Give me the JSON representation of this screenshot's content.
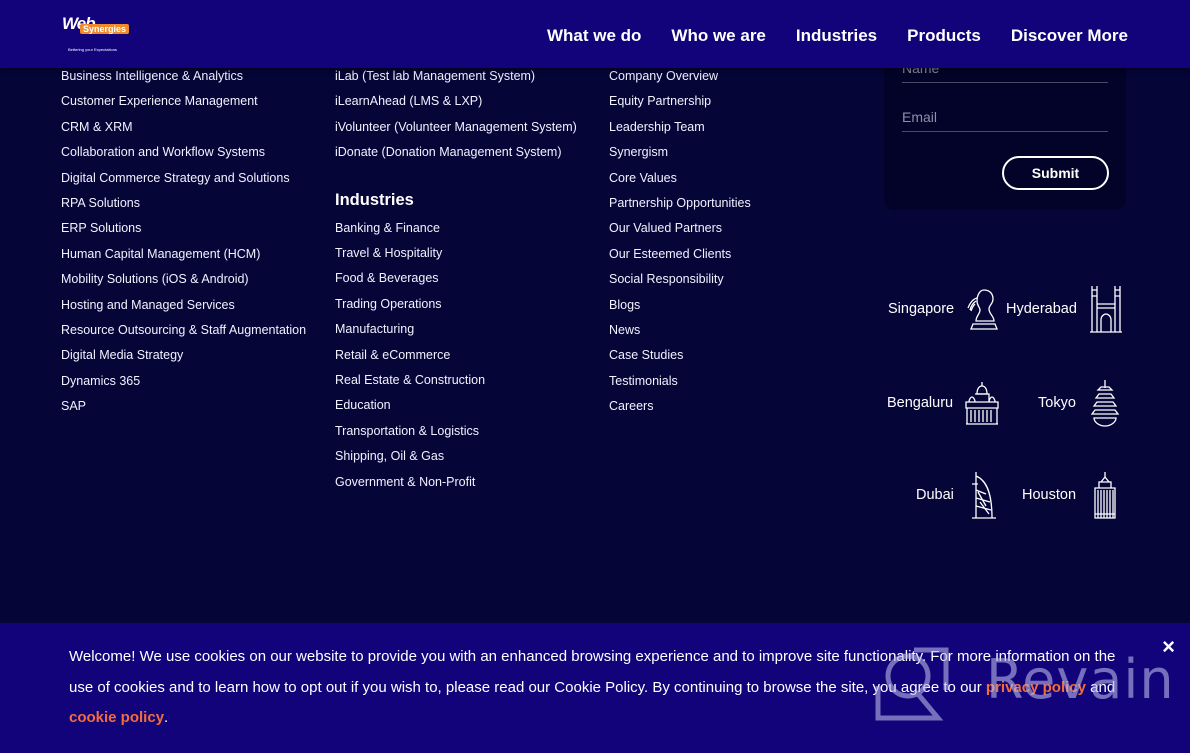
{
  "header": {
    "logo": {
      "word1": "Web",
      "word2": "Synergies",
      "tagline": "Bettering your Expectations"
    },
    "nav": [
      "What we do",
      "Who we are",
      "Industries",
      "Products",
      "Discover More"
    ]
  },
  "services": {
    "items": [
      "Business Intelligence & Analytics",
      "Customer Experience Management",
      "CRM & XRM",
      "Collaboration and Workflow Systems",
      "Digital Commerce Strategy and Solutions",
      "RPA Solutions",
      "ERP Solutions",
      "Human Capital Management (HCM)",
      "Mobility Solutions (iOS & Android)",
      "Hosting and Managed Services",
      "Resource Outsourcing & Staff Augmentation",
      "Digital Media Strategy",
      "Dynamics 365",
      "SAP"
    ]
  },
  "products": {
    "items": [
      "iLab (Test lab Management System)",
      "iLearnAhead (LMS & LXP)",
      "iVolunteer (Volunteer Management System)",
      "iDonate (Donation Management System)"
    ]
  },
  "industries": {
    "title": "Industries",
    "items": [
      "Banking & Finance",
      "Travel & Hospitality",
      "Food & Beverages",
      "Trading Operations",
      "Manufacturing",
      "Retail & eCommerce",
      "Real Estate & Construction",
      "Education",
      "Transportation & Logistics",
      "Shipping, Oil & Gas",
      "Government & Non-Profit"
    ]
  },
  "about": {
    "items": [
      "Company Overview",
      "Equity Partnership",
      "Leadership Team",
      "Synergism",
      "Core Values",
      "Partnership Opportunities",
      "Our Valued Partners",
      "Our Esteemed Clients",
      "Social Responsibility",
      "Blogs",
      "News",
      "Case Studies",
      "Testimonials",
      "Careers"
    ]
  },
  "contact_form": {
    "name_placeholder": "Name",
    "email_placeholder": "Email",
    "submit_label": "Submit"
  },
  "cities": [
    {
      "name": "Singapore",
      "icon": "merlion-icon"
    },
    {
      "name": "Hyderabad",
      "icon": "charminar-icon"
    },
    {
      "name": "Bengaluru",
      "icon": "vidhana-soudha-icon"
    },
    {
      "name": "Tokyo",
      "icon": "pagoda-icon"
    },
    {
      "name": "Dubai",
      "icon": "burj-al-arab-icon"
    },
    {
      "name": "Houston",
      "icon": "skyscraper-icon"
    }
  ],
  "cookie_banner": {
    "text_before": "Welcome! We use cookies on our website to provide you with an enhanced browsing experience and to improve site functionality. For more information on the use of cookies and to learn how to opt out if you wish to, please read our Cookie Policy. By continuing to browse the site, you agree to our ",
    "privacy_link": "privacy policy",
    "text_middle": " and ",
    "cookie_link": "cookie policy",
    "text_after": ".",
    "close_label": "×"
  },
  "watermark": {
    "text": "Revain"
  },
  "colors": {
    "header_bg": "#12037a",
    "page_bg": "#050538",
    "accent_link": "#f26d3d"
  }
}
